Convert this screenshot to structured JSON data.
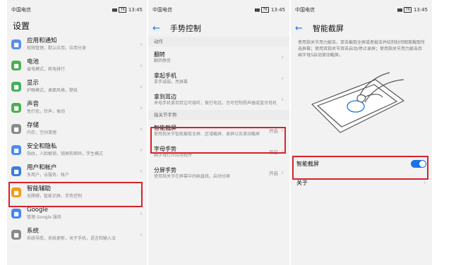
{
  "statusbar": {
    "carrier": "中国电信",
    "time": "13:45"
  },
  "settings": {
    "title": "设置",
    "items": [
      {
        "title": "应用和通知",
        "sub": "权限管理，默认应用，应用分身",
        "icon": "apps-icon",
        "color": "#5b8def"
      },
      {
        "title": "电池",
        "sub": "省电模式，耗电排行",
        "icon": "battery-icon",
        "color": "#4caf50"
      },
      {
        "title": "显示",
        "sub": "护眼模式，桌面风格，壁纸",
        "icon": "display-icon",
        "color": "#43b05c"
      },
      {
        "title": "声音",
        "sub": "免打扰，铃声，振动",
        "icon": "sound-icon",
        "color": "#4caf50"
      },
      {
        "title": "存储",
        "sub": "内存，空间清理",
        "icon": "storage-icon",
        "color": "#8a8a8a"
      },
      {
        "title": "安全和隐私",
        "sub": "指纹，人脸解锁，锁屏和密码，学生模式",
        "icon": "lock-icon",
        "color": "#4a8af4"
      },
      {
        "title": "用户和帐户",
        "sub": "多用户，云服务，帐户",
        "icon": "user-icon",
        "color": "#3d7bd9"
      },
      {
        "title": "智能辅助",
        "sub": "无障碍，智能识屏，手势控制",
        "icon": "hand-icon",
        "color": "#f39c12"
      },
      {
        "title": "Google",
        "sub": "管理 Google 服务",
        "icon": "google-icon",
        "color": "#4285f4"
      },
      {
        "title": "系统",
        "sub": "系统导航，系统更新，关于手机，语言和输入法",
        "icon": "phone-icon",
        "color": "#8a8a8a"
      }
    ]
  },
  "gesture": {
    "title": "手势控制",
    "section_action": "动作",
    "actions": [
      {
        "title": "翻转",
        "sub": "翻转静音"
      },
      {
        "title": "拿起手机",
        "sub": "拿手减弱，亮屏幕"
      },
      {
        "title": "拿到耳边",
        "sub": "来电手机拿到耳边可接听，拨打电话，也可控制扬声器或蓝牙耳机"
      }
    ],
    "section_knuckle": "指关节手势",
    "knuckle": [
      {
        "title": "智能截屏",
        "sub": "使用指关节智能截取全屏、区域截屏、录屏以及滚动截屏",
        "state": "开启"
      },
      {
        "title": "字母手势",
        "sub": "画字母打开应用程序",
        "state": "开启"
      },
      {
        "title": "分屏手势",
        "sub": "使用指关节在屏幕中间画直线，启动分屏",
        "state": "开启"
      }
    ]
  },
  "screenshot": {
    "title": "智能截屏",
    "description": "使用指关节用力敲击，双击截取全屏或者敲击并绘制封闭图案截取所选屏幕；使用双指关节双击启动/停止录屏；使用指关节用力敲击后画字母S启动滚动截屏。",
    "toggle_label": "智能截屏",
    "toggle_on": true,
    "about_label": "关于"
  },
  "colors": {
    "accent": "#1a73e8",
    "highlight": "#d8232a"
  }
}
